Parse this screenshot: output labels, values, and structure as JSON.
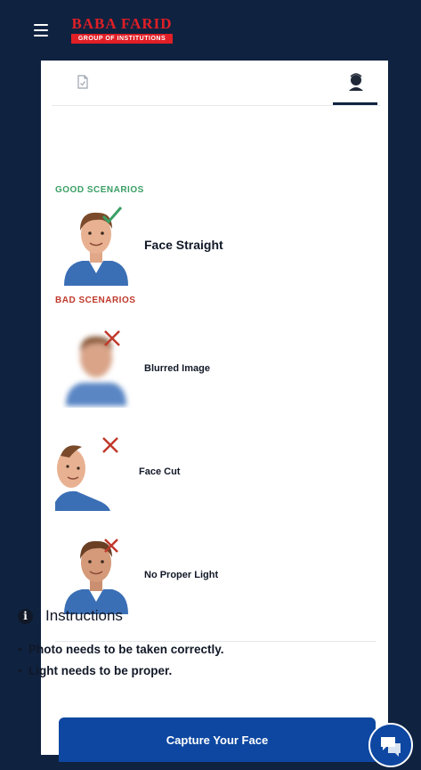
{
  "header": {
    "logo_top": "BABA FARID",
    "logo_bottom": "GROUP OF INSTITUTIONS",
    "menu_icon": "hamburger-icon"
  },
  "tabs": [
    {
      "icon": "document-icon",
      "active": false
    },
    {
      "icon": "face-icon",
      "active": true
    }
  ],
  "good_section": {
    "label": "GOOD SCENARIOS",
    "items": [
      {
        "label": "Face Straight",
        "mark": "check-icon"
      }
    ]
  },
  "bad_section": {
    "label": "BAD SCENARIOS",
    "items": [
      {
        "label": "Blurred Image",
        "mark": "cross-icon"
      },
      {
        "label": "Face Cut",
        "mark": "cross-icon"
      },
      {
        "label": "No Proper Light",
        "mark": "cross-icon"
      }
    ]
  },
  "instructions": {
    "title": "Instructions",
    "items": [
      "Photo needs to be taken correctly.",
      "Light needs to be proper."
    ]
  },
  "capture_button": "Capture Your Face",
  "colors": {
    "navy": "#0f2240",
    "primary": "#0d47a1",
    "good": "#3a9f64",
    "bad": "#c0392b",
    "brand_red": "#e01f26"
  }
}
